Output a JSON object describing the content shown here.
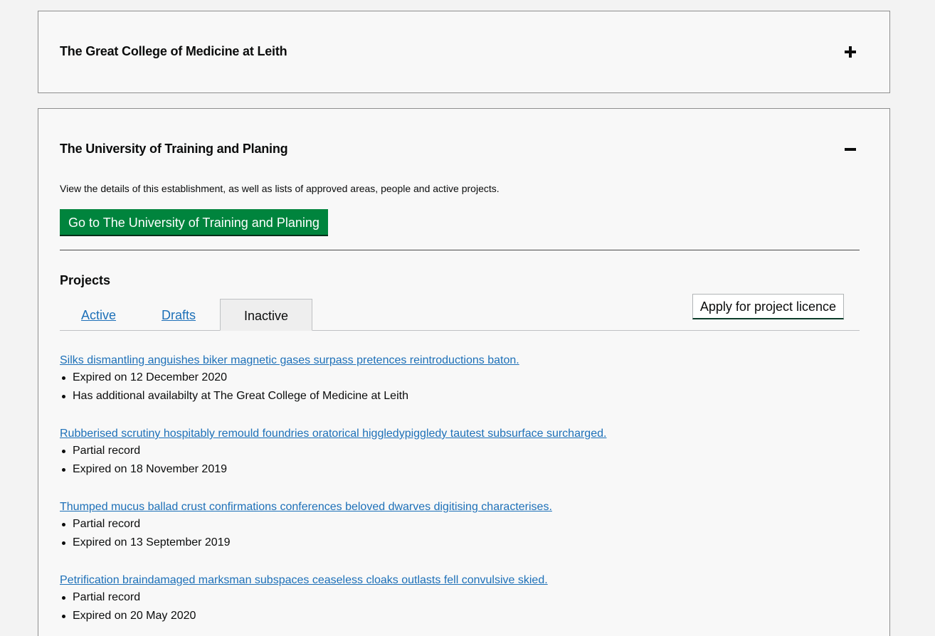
{
  "establishments": [
    {
      "title": "The Great College of Medicine at Leith",
      "toggle": "+"
    },
    {
      "title": "The University of Training and Planing",
      "toggle": "−",
      "description": "View the details of this establishment, as well as lists of approved areas, people and active projects.",
      "go_button": "Go to The University of Training and Planing",
      "projects_heading": "Projects",
      "tabs": [
        {
          "label": "Active",
          "selected": false
        },
        {
          "label": "Drafts",
          "selected": false
        },
        {
          "label": "Inactive",
          "selected": true
        }
      ],
      "apply_button": "Apply for project licence",
      "projects": [
        {
          "title": "Silks dismantling anguishes biker magnetic gases surpass pretences reintroductions baton.",
          "meta": [
            "Expired on 12 December 2020",
            "Has additional availabilty at The Great College of Medicine at Leith"
          ]
        },
        {
          "title": "Rubberised scrutiny hospitably remould foundries oratorical higgledypiggledy tautest subsurface surcharged.",
          "meta": [
            "Partial record",
            "Expired on 18 November 2019"
          ]
        },
        {
          "title": "Thumped mucus ballad crust confirmations conferences beloved dwarves digitising characterises.",
          "meta": [
            "Partial record",
            "Expired on 13 September 2019"
          ]
        },
        {
          "title": "Petrification braindamaged marksman subspaces ceaseless cloaks outlasts fell convulsive skied.",
          "meta": [
            "Partial record",
            "Expired on 20 May 2020"
          ]
        }
      ]
    }
  ],
  "colors": {
    "link": "#1d70b8",
    "primary_button": "#00843d",
    "text": "#0b0c0c"
  },
  "icons": {
    "expand": "plus-icon",
    "collapse": "minus-icon"
  }
}
